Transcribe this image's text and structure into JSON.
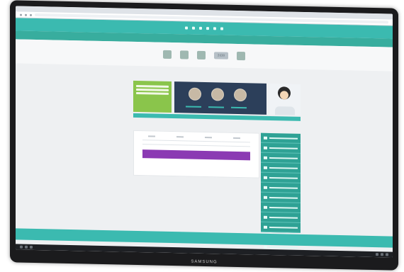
{
  "monitor": {
    "brand": "SAMSUNG"
  },
  "website": {
    "top_bar": {
      "social_icons": [
        "facebook-icon",
        "twitter-icon",
        "youtube-icon",
        "instagram-icon",
        "snapchat-icon",
        "link-icon"
      ]
    },
    "nav": {
      "links": [
        "",
        "",
        ""
      ]
    },
    "logos": {
      "vision_label": "2030"
    },
    "hero": {
      "green_box_lines": [
        "",
        "",
        ""
      ],
      "banner_items": [
        "",
        "",
        ""
      ]
    },
    "sidebar": {
      "items": [
        "",
        "",
        "",
        "",
        "",
        "",
        "",
        "",
        "",
        "",
        "",
        "",
        "",
        ""
      ]
    },
    "content": {
      "grid_labels": [
        "",
        "",
        "",
        "",
        ""
      ]
    },
    "footer": {
      "contact_text": "",
      "center_text": "",
      "right_text": ""
    }
  },
  "colors": {
    "teal": "#3bbab0",
    "dark_teal": "#2fa295",
    "green": "#8ac54b",
    "purple": "#8b3ab3",
    "navy": "#2c3f5a"
  }
}
